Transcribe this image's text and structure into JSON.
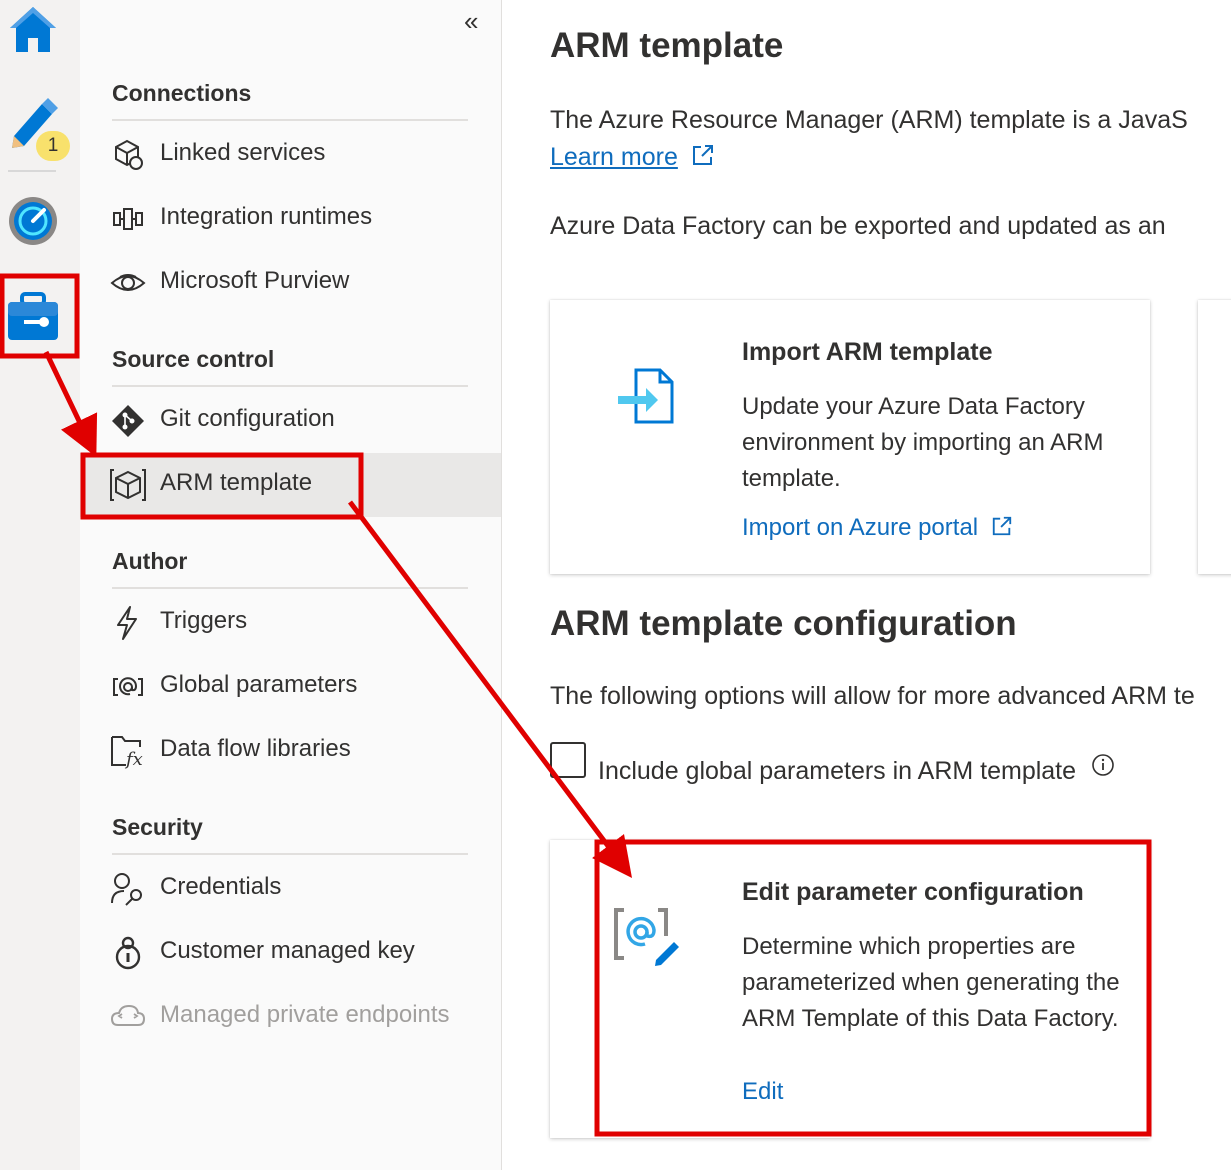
{
  "rail": {
    "items": [
      {
        "name": "home-icon"
      },
      {
        "name": "author-pencil-icon",
        "badge": "1"
      },
      {
        "name": "monitor-gauge-icon"
      },
      {
        "name": "manage-toolbox-icon"
      }
    ]
  },
  "nav": {
    "collapse_glyph": "«",
    "sections": {
      "connections": "Connections",
      "source_control": "Source control",
      "author": "Author",
      "security": "Security"
    },
    "items": {
      "linked_services": "Linked services",
      "integration_runtimes": "Integration runtimes",
      "microsoft_purview": "Microsoft Purview",
      "git_configuration": "Git configuration",
      "arm_template": "ARM template",
      "triggers": "Triggers",
      "global_parameters": "Global parameters",
      "data_flow_libraries": "Data flow libraries",
      "credentials": "Credentials",
      "customer_managed_key": "Customer managed key",
      "managed_private_endpoints": "Managed private endpoints"
    }
  },
  "main": {
    "title": "ARM template",
    "intro": "The Azure Resource Manager (ARM) template is a JavaS",
    "learn_more": "Learn more",
    "export_text": "Azure Data Factory can be exported and updated as an",
    "import_card": {
      "title": "Import ARM template",
      "description": "Update your Azure Data Factory environment by importing an ARM template.",
      "link": "Import on Azure portal"
    },
    "config_title": "ARM template configuration",
    "config_text": "The following options will allow for more advanced ARM te",
    "checkbox_label": "Include global parameters in ARM template",
    "checkbox_checked": false,
    "edit_card": {
      "title": "Edit parameter configuration",
      "description": "Determine which properties are parameterized when generating the ARM Template of this Data Factory.",
      "link": "Edit"
    }
  },
  "colors": {
    "highlight_red": "#e00000",
    "link_blue": "#0f6cbd",
    "azure_blue": "#0078d4"
  }
}
